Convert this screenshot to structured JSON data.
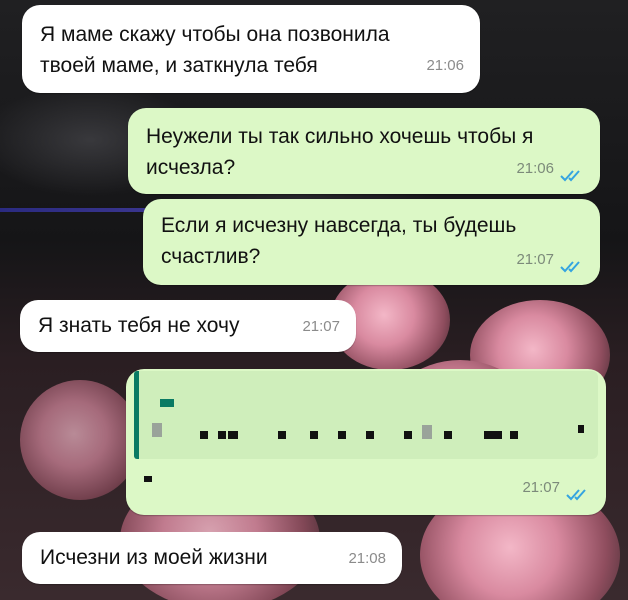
{
  "messages": [
    {
      "text": "Я маме скажу чтобы она позвонила твоей маме, и заткнула тебя",
      "time": "21:06",
      "direction": "incoming"
    },
    {
      "text": "Неужели ты так сильно хочешь чтобы я исчезла?",
      "time": "21:06",
      "direction": "outgoing",
      "status": "read"
    },
    {
      "text": "Если я исчезну навсегда, ты будешь счастлив?",
      "time": "21:07",
      "direction": "outgoing",
      "status": "read"
    },
    {
      "text": "Я знать тебя не хочу",
      "time": "21:07",
      "direction": "incoming"
    },
    {
      "text": "",
      "time": "21:07",
      "direction": "outgoing",
      "status": "read",
      "note": "pixelated reply quote"
    },
    {
      "text": "Исчезни из моей жизни",
      "time": "21:08",
      "direction": "incoming"
    }
  ],
  "colors": {
    "incoming_bubble": "#ffffff",
    "outgoing_bubble": "#dcf8c6",
    "read_ticks": "#34a4e0",
    "quote_accent": "#0a7a63"
  },
  "icons": {
    "read_receipt": "double-check-icon"
  }
}
